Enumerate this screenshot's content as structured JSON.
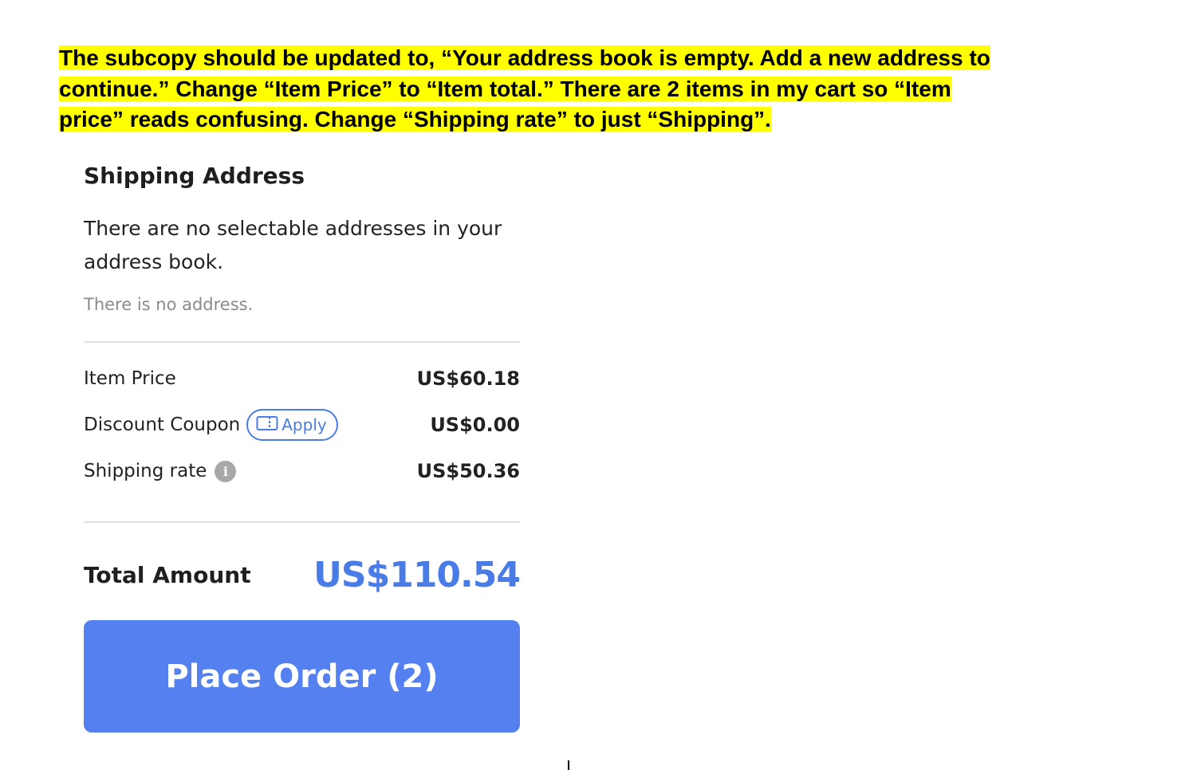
{
  "annotation": {
    "line1": "The subcopy should be updated to, “Your address book is empty. Add a new address to",
    "line2": "continue.” Change “Item Price” to “Item total.” There are 2 items in my cart so “Item",
    "line3": "price” reads confusing. Change “Shipping rate” to just “Shipping”."
  },
  "shipping": {
    "title": "Shipping Address",
    "subcopy": "There are no selectable addresses in your address book.",
    "no_address": "There is no address."
  },
  "summary": {
    "item_price_label": "Item Price",
    "item_price_value": "US$60.18",
    "discount_label": "Discount Coupon",
    "apply_label": "Apply",
    "discount_value": "US$0.00",
    "shipping_label": "Shipping rate",
    "shipping_value": "US$50.36",
    "info_glyph": "i"
  },
  "total": {
    "label": "Total Amount",
    "value": "US$110.54"
  },
  "place_order": {
    "label": "Place Order (2)"
  },
  "colors": {
    "highlight": "#ffff00",
    "accent": "#4a7ce8",
    "button": "#5581f0"
  },
  "icons": {
    "coupon": "coupon-icon",
    "info": "info-icon"
  }
}
